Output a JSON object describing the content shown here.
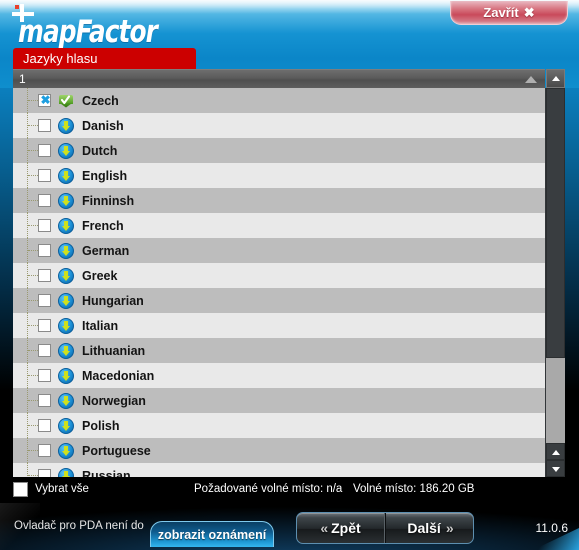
{
  "window": {
    "brand": "mapFactor",
    "close_label": "Zavřít",
    "close_icon": "close-x-icon",
    "version": "11.0.6"
  },
  "tabs": [
    {
      "label": "Jazyky hlasu",
      "active": true
    }
  ],
  "list": {
    "column_header": "1",
    "sort_icon": "sort-ascending-icon",
    "header_button_icon": "triangle-up-icon",
    "rows": [
      {
        "label": "Czech",
        "checked": true,
        "icon": "installed-icon",
        "selected": true
      },
      {
        "label": "Danish",
        "checked": false,
        "icon": "download-icon",
        "selected": false
      },
      {
        "label": "Dutch",
        "checked": false,
        "icon": "download-icon",
        "selected": false
      },
      {
        "label": "English",
        "checked": false,
        "icon": "download-icon",
        "selected": false
      },
      {
        "label": "Finninsh",
        "checked": false,
        "icon": "download-icon",
        "selected": false
      },
      {
        "label": "French",
        "checked": false,
        "icon": "download-icon",
        "selected": false
      },
      {
        "label": "German",
        "checked": false,
        "icon": "download-icon",
        "selected": false
      },
      {
        "label": "Greek",
        "checked": false,
        "icon": "download-icon",
        "selected": false
      },
      {
        "label": "Hungarian",
        "checked": false,
        "icon": "download-icon",
        "selected": false
      },
      {
        "label": "Italian",
        "checked": false,
        "icon": "download-icon",
        "selected": false
      },
      {
        "label": "Lithuanian",
        "checked": false,
        "icon": "download-icon",
        "selected": false
      },
      {
        "label": "Macedonian",
        "checked": false,
        "icon": "download-icon",
        "selected": false
      },
      {
        "label": "Norwegian",
        "checked": false,
        "icon": "download-icon",
        "selected": false
      },
      {
        "label": "Polish",
        "checked": false,
        "icon": "download-icon",
        "selected": false
      },
      {
        "label": "Portuguese",
        "checked": false,
        "icon": "download-icon",
        "selected": false
      },
      {
        "label": "Russian",
        "checked": false,
        "icon": "download-icon",
        "selected": false
      }
    ]
  },
  "scrollbar": {
    "up_icon": "triangle-up-icon",
    "down_icon": "triangle-down-icon"
  },
  "status": {
    "select_all_label": "Vybrat vše",
    "select_all_checked": false,
    "space_required": "Požadované volné místo: n/a",
    "space_free": "Volné místo: 186.20 GB"
  },
  "footer": {
    "driver_message": "Ovladač pro PDA není do",
    "show_notice_label": "zobrazit oznámení",
    "back_label": "Zpět",
    "next_label": "Další",
    "back_chevron": "«",
    "next_chevron": "»"
  },
  "colors": {
    "header_blue": "#1593d2",
    "tab_red": "#cc0000",
    "close_pink": "#c94a5b",
    "row_dark": "#bdbdbd",
    "row_light": "#e9e9e9",
    "notice_blue": "#1f9ad6"
  }
}
